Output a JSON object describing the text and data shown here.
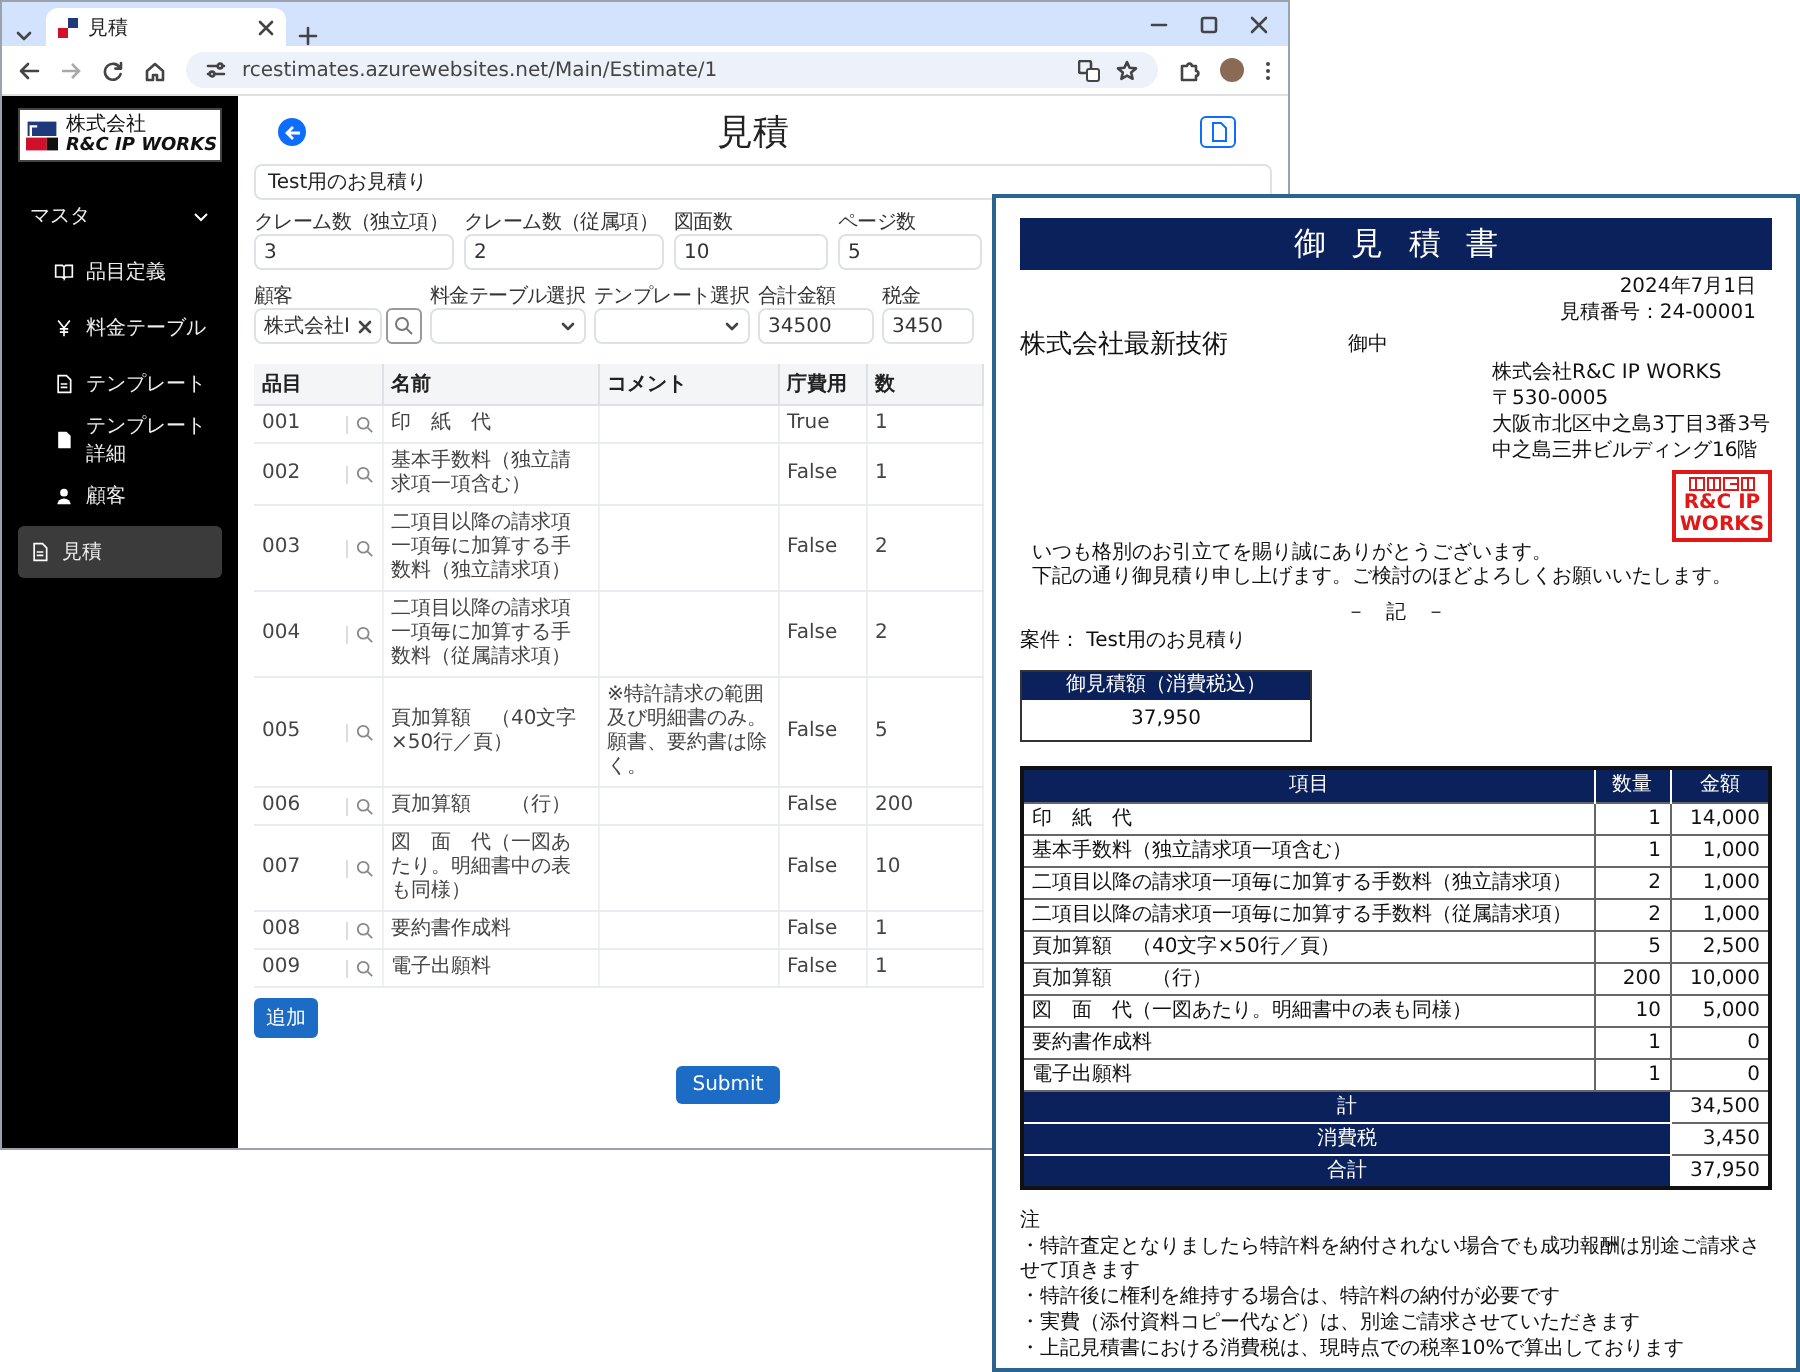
{
  "browser": {
    "tab_title": "見積",
    "url": "rcestimates.azurewebsites.net/Main/Estimate/1"
  },
  "sidebar": {
    "logo": {
      "company_type": "株式会社",
      "name": "R&C IP WORKS"
    },
    "nav": [
      {
        "label": "マスタ",
        "expanded": true,
        "selected": false,
        "children": [
          {
            "label": "品目定義",
            "selected": false
          },
          {
            "label": "料金テーブル",
            "selected": false
          },
          {
            "label": "テンプレート",
            "selected": false
          },
          {
            "label": "テンプレート詳細",
            "selected": false
          },
          {
            "label": "顧客",
            "selected": false
          }
        ]
      },
      {
        "label": "見積",
        "selected": true
      }
    ]
  },
  "header": {
    "title": "見積"
  },
  "subject": {
    "value": "Test用のお見積り"
  },
  "fields": [
    {
      "kind": "text",
      "label": "クレーム数（独立項）",
      "value": "3"
    },
    {
      "kind": "text",
      "label": "クレーム数（従属項）",
      "value": "2"
    },
    {
      "kind": "text",
      "label": "図面数",
      "value": "10"
    },
    {
      "kind": "text",
      "label": "ページ数",
      "value": "5"
    }
  ],
  "fields_2": [
    {
      "kind": "lookup",
      "label": "顧客",
      "value": "株式会社I"
    },
    {
      "kind": "select",
      "label": "料金テーブル選択"
    },
    {
      "kind": "select",
      "label": "テンプレート選択"
    },
    {
      "kind": "text",
      "label": "合計金額",
      "value": "34500"
    },
    {
      "kind": "text",
      "label": "税金",
      "value": "3450"
    }
  ],
  "table": {
    "columns": [
      "品目",
      "名前",
      "コメント",
      "庁費用",
      "数"
    ],
    "rows": [
      {
        "code": "001",
        "name": "印　紙　代",
        "official_fee": "True",
        "quantity": "1"
      },
      {
        "code": "002",
        "name": "基本手数料（独立請求項一項含む）",
        "official_fee": "False",
        "quantity": "1"
      },
      {
        "code": "003",
        "name": "二項目以降の請求項一項毎に加算する手数料（独立請求項）",
        "official_fee": "False",
        "quantity": "2"
      },
      {
        "code": "004",
        "name": "二項目以降の請求項一項毎に加算する手数料（従属請求項）",
        "official_fee": "False",
        "quantity": "2"
      },
      {
        "code": "005",
        "name": "頁加算額　（40文字×50行／頁）",
        "comment": "※特許請求の範囲及び明細書のみ。願書、要約書は除く。",
        "official_fee": "False",
        "quantity": "5"
      },
      {
        "code": "006",
        "name": "頁加算額　　（行）",
        "official_fee": "False",
        "quantity": "200"
      },
      {
        "code": "007",
        "name": "図　面　代（一図あたり。明細書中の表も同様）",
        "official_fee": "False",
        "quantity": "10"
      },
      {
        "code": "008",
        "name": "要約書作成料",
        "official_fee": "False",
        "quantity": "1"
      },
      {
        "code": "009",
        "name": "電子出願料",
        "official_fee": "False",
        "quantity": "1"
      }
    ]
  },
  "buttons": {
    "add": "追加",
    "submit": "Submit"
  },
  "document": {
    "title": "御見積書",
    "date": "2024年7月1日",
    "number": "見積番号：24-00001",
    "customer": "株式会社最新技術",
    "honorific": "御中",
    "company_lines": [
      "株式会社R&C IP WORKS",
      "〒530-0005",
      "大阪市北区中之島3丁目3番3号",
      "中之島三井ビルディング16階"
    ],
    "seal": "R&C IP WORKS",
    "greeting": [
      "いつも格別のお引立てを賜り誠にありがとうございます。",
      "下記の通り御見積り申し上げます。ご検討のほどよろしくお願いいたします。"
    ],
    "record_mark": "－　記　－",
    "case": "案件：  Test用のお見積り",
    "total_box": {
      "label": "御見積額（消費税込）",
      "value": "37,950"
    },
    "columns": [
      "項目",
      "数量",
      "金額"
    ],
    "rows": [
      {
        "item": "印　紙　代",
        "quantity": "1",
        "amount": "14,000"
      },
      {
        "item": "基本手数料（独立請求項一項含む）",
        "quantity": "1",
        "amount": "1,000"
      },
      {
        "item": "二項目以降の請求項一項毎に加算する手数料（独立請求項）",
        "quantity": "2",
        "amount": "1,000"
      },
      {
        "item": "二項目以降の請求項一項毎に加算する手数料（従属請求項）",
        "quantity": "2",
        "amount": "1,000"
      },
      {
        "item": "頁加算額　（40文字×50行／頁）",
        "quantity": "5",
        "amount": "2,500"
      },
      {
        "item": "頁加算額　　（行）",
        "quantity": "200",
        "amount": "10,000"
      },
      {
        "item": "図　面　代（一図あたり。明細書中の表も同様）",
        "quantity": "10",
        "amount": "5,000"
      },
      {
        "item": "要約書作成料",
        "quantity": "1",
        "amount": "0"
      },
      {
        "item": "電子出願料",
        "quantity": "1",
        "amount": "0"
      }
    ],
    "totals": [
      {
        "label": "計",
        "value": "34,500"
      },
      {
        "label": "消費税",
        "value": "3,450"
      },
      {
        "label": "合計",
        "value": "37,950"
      }
    ],
    "notes_title": "注",
    "notes": [
      "・特許査定となりましたら特許料を納付されない場合でも成功報酬は別途ご請求させて頂きます",
      "・特許後に権利を維持する場合は、特許料の納付が必要です",
      "・実費（添付資料コピー代など）は、別途ご請求させていただきます",
      "・上記見積書における消費税は、現時点での税率10%で算出しております"
    ]
  }
}
